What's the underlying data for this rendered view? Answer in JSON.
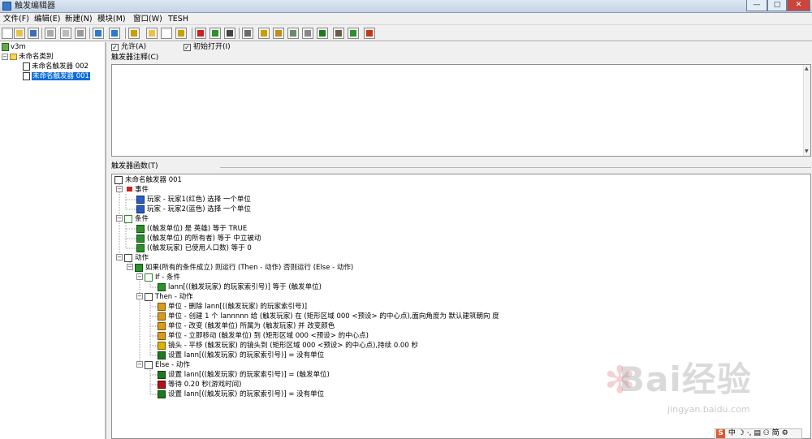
{
  "window": {
    "title": "触发编辑器",
    "buttons": {
      "minimize": "—",
      "maximize": "□",
      "close": "✕"
    }
  },
  "menubar": [
    {
      "label": "文件(F)"
    },
    {
      "label": "编辑(E)"
    },
    {
      "label": "新建(N)"
    },
    {
      "label": "模块(M)"
    },
    {
      "label": "窗口(W)"
    },
    {
      "label": "TESH"
    }
  ],
  "toolbar_icons": [
    "new-file",
    "open-folder",
    "save",
    "cut",
    "copy",
    "paste",
    "undo",
    "redo",
    "test-map",
    "new-category",
    "new-trigger",
    "new-comment",
    "trigger-flag",
    "event",
    "action",
    "terrain-editor",
    "unit-editor",
    "sound-editor",
    "object-editor",
    "script-editor",
    "camera-editor",
    "region-editor",
    "ai-editor",
    "import-manager"
  ],
  "left_tree": {
    "map_name": "v3m",
    "category": "未命名类别",
    "triggers": [
      {
        "label": "未命名触发器 002",
        "selected": false
      },
      {
        "label": "未命名触发器 001",
        "selected": true
      }
    ]
  },
  "options": {
    "enabled_label": "允许(A)",
    "enabled_checked": true,
    "initially_on_label": "初始打开(I)",
    "initially_on_checked": true
  },
  "comment": {
    "label": "触发器注释(C)",
    "value": ""
  },
  "functions": {
    "label": "触发器函数(T)",
    "root": "未命名触发器 001",
    "events_label": "事件",
    "events": [
      "玩家 - 玩家1(红色) 选择 一个单位",
      "玩家 - 玩家2(蓝色) 选择 一个单位"
    ],
    "conditions_label": "条件",
    "conditions": [
      "((触发单位) 是 英雄) 等于 TRUE",
      "((触发单位) 的所有者) 等于 中立被动",
      "((触发玩家) 已使用人口数) 等于 0"
    ],
    "actions_label": "动作",
    "if_action": "如果(所有的条件成立) 则运行 (Then - 动作) 否则运行 (Else - 动作)",
    "if_label": "If - 条件",
    "if_conditions": [
      "lann[((触发玩家) 的玩家索引号)] 等于 (触发单位)"
    ],
    "then_label": "Then - 动作",
    "then_actions": [
      {
        "icon": "unit",
        "text": "单位 - 删除 lann[((触发玩家) 的玩家索引号)]"
      },
      {
        "icon": "unit",
        "text": "单位 - 创建 1 个 lannnnn 给 (触发玩家) 在 (矩形区域 000 <预设> 的中心点),面向角度为 默认建筑朝向 度"
      },
      {
        "icon": "unit",
        "text": "单位 - 改变 (触发单位) 所属为 (触发玩家) 并 改变颜色"
      },
      {
        "icon": "unit",
        "text": "单位 - 立即移动 (触发单位) 到 (矩形区域 000 <预设> 的中心点)"
      },
      {
        "icon": "camera",
        "text": "镜头 - 平移 (触发玩家) 的镜头到 (矩形区域 000 <预设> 的中心点),持续 0.00 秒"
      },
      {
        "icon": "variable",
        "text": "设置 lann[((触发玩家) 的玩家索引号)] = 没有单位"
      }
    ],
    "else_label": "Else - 动作",
    "else_actions": [
      {
        "icon": "variable",
        "text": "设置 lann[((触发玩家) 的玩家索引号)] = (触发单位)"
      },
      {
        "icon": "wait",
        "text": "等待 0.20 秒(游戏时间)"
      },
      {
        "icon": "variable",
        "text": "设置 lann[((触发玩家) 的玩家索引号)] = 没有单位"
      }
    ]
  },
  "ime_bar": {
    "badge": "S",
    "mode": "中",
    "items": [
      "☽",
      "·,",
      "▤",
      "⚇"
    ],
    "simplified": "简",
    "tool": "⚙"
  },
  "watermark": {
    "brand": "Bai经验",
    "url": "jingyan.baidu.com"
  },
  "colors": {
    "selection": "#0b6cd9",
    "event_flag": "#d21f1f",
    "condition": "#2d8f2d",
    "close_button": "#c9463d"
  }
}
